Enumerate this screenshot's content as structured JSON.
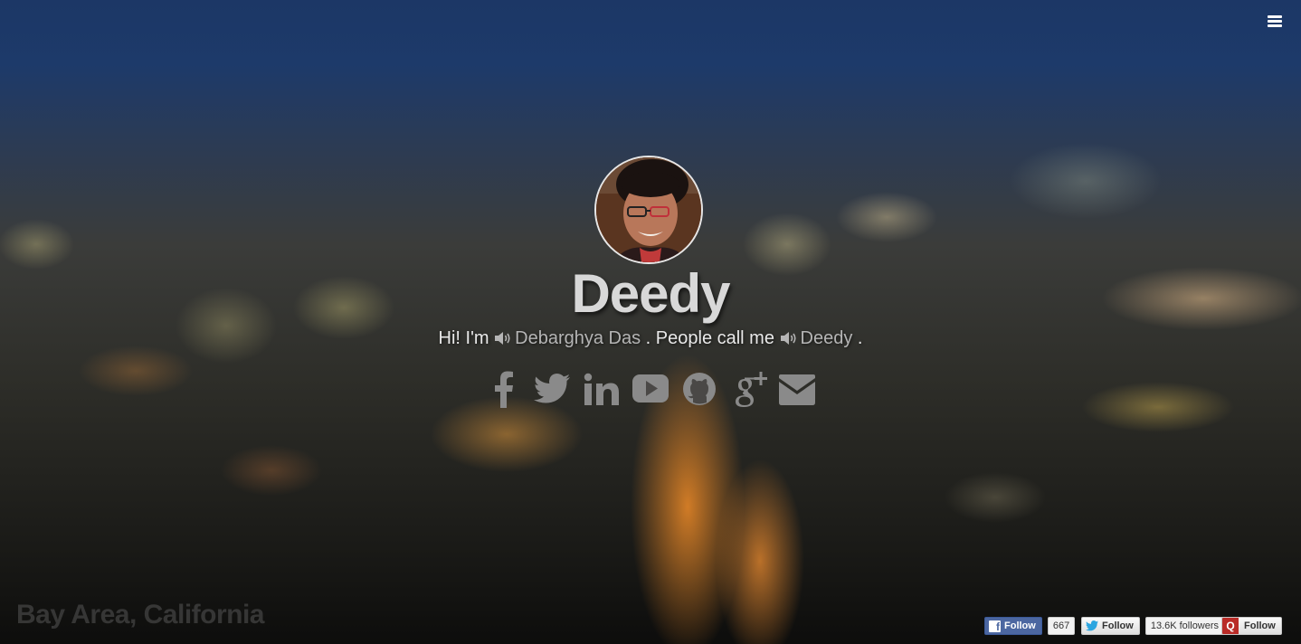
{
  "header": {
    "menu_icon": "hamburger-menu-icon"
  },
  "profile": {
    "name": "Deedy",
    "intro_prefix": "Hi! I'm",
    "full_name": "Debarghya Das",
    "middle_text": ". People call me",
    "nickname": "Deedy",
    "suffix": ".",
    "speaker_icon": "speaker-icon"
  },
  "socials": [
    {
      "name": "facebook",
      "icon": "facebook-icon"
    },
    {
      "name": "twitter",
      "icon": "twitter-icon"
    },
    {
      "name": "linkedin",
      "icon": "linkedin-icon"
    },
    {
      "name": "youtube",
      "icon": "youtube-icon"
    },
    {
      "name": "github",
      "icon": "github-icon"
    },
    {
      "name": "google-plus",
      "icon": "google-plus-icon"
    },
    {
      "name": "email",
      "icon": "envelope-icon"
    }
  ],
  "location": "Bay Area, California",
  "follow_buttons": {
    "facebook": {
      "label": "Follow",
      "count": "667"
    },
    "twitter": {
      "label": "Follow",
      "count": "13.6K followers"
    },
    "quora": {
      "label": "Follow",
      "mark": "Q"
    }
  },
  "colors": {
    "icon_gray": "#8a8a8a",
    "name_text": "#d8d8d8",
    "facebook_blue": "#4c67a1",
    "quora_red": "#b92b27"
  }
}
